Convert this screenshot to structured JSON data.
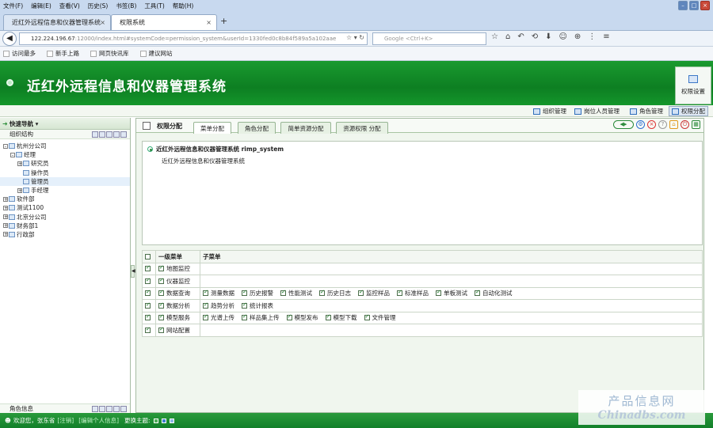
{
  "browser": {
    "menu": [
      "文件(F)",
      "编辑(E)",
      "查看(V)",
      "历史(S)",
      "书签(B)",
      "工具(T)",
      "帮助(H)"
    ],
    "tabs": [
      {
        "label": "近红外远程信息和仪器管理系统",
        "active": false
      },
      {
        "label": "权限系统",
        "active": true
      }
    ],
    "url_host": "122.224.196.67",
    "url_path": ":12000/index.html#systemCode=permission_system&userId=1330fed0c8b84f589a5a102aae",
    "search_placeholder": "Google <Ctrl+K>",
    "bookmarks": [
      "访问最多",
      "新手上路",
      "网页快讯库",
      "建议网站"
    ]
  },
  "app": {
    "title": "近红外远程信息和仪器管理系统",
    "header_button": "权限设置",
    "function_tabs": [
      "组织管理",
      "岗位人员管理",
      "角色管理",
      "权限分配"
    ],
    "active_function_tab": "权限分配"
  },
  "left_panel": {
    "nav_title": "快速导航",
    "org_title": "组织结构",
    "role_title": "角色信息",
    "tree": [
      {
        "label": "杭州分公司",
        "level": 0,
        "pm": "-"
      },
      {
        "label": "经理",
        "level": 1,
        "pm": "-"
      },
      {
        "label": "研究员",
        "level": 2,
        "pm": "+"
      },
      {
        "label": "操作员",
        "level": 2,
        "pm": ""
      },
      {
        "label": "管理员",
        "level": 2,
        "pm": "",
        "selected": true
      },
      {
        "label": "手经理",
        "level": 2,
        "pm": "+"
      },
      {
        "label": "软件部",
        "level": 0,
        "pm": "+"
      },
      {
        "label": "测试1100",
        "level": 0,
        "pm": "+"
      },
      {
        "label": "北京分公司",
        "level": 0,
        "pm": "+"
      },
      {
        "label": "财务部1",
        "level": 0,
        "pm": "+"
      },
      {
        "label": "行政部",
        "level": 0,
        "pm": "+"
      }
    ]
  },
  "main": {
    "panel_title": "权限分配",
    "tabs": [
      "菜单分配",
      "角色分配",
      "简单资源分配",
      "资源权限 分配"
    ],
    "active_tab": "菜单分配",
    "system_name": "近红外远程信息和仪器管理系统 rimp_system",
    "system_desc": "近红外远程信息和仪器管理系统",
    "table_headers": {
      "level1": "一级菜单",
      "sub": "子菜单"
    },
    "menus": [
      {
        "name": "地图监控",
        "subs": []
      },
      {
        "name": "仪器监控",
        "subs": []
      },
      {
        "name": "数据查询",
        "subs": [
          "测量数据",
          "历史报警",
          "性能测试",
          "历史日志",
          "监控样品",
          "标准样品",
          "单板测试",
          "自动化测试"
        ]
      },
      {
        "name": "数据分析",
        "subs": [
          "趋势分析",
          "统计报表"
        ]
      },
      {
        "name": "模型服务",
        "subs": [
          "光谱上传",
          "样品集上传",
          "模型发布",
          "模型下载",
          "文件管理"
        ]
      },
      {
        "name": "网站配置",
        "subs": []
      }
    ]
  },
  "status": {
    "welcome": "欢迎您，张东省",
    "logout": "[注销]",
    "edit_profile": "[编辑个人信息]",
    "theme_label": "更换主题:",
    "theme_colors": [
      "#4fae5a",
      "#3f7fd0",
      "#8fb8e6"
    ]
  },
  "watermark": {
    "line1": "产品信息网",
    "line2": "Chinadbs.com"
  }
}
